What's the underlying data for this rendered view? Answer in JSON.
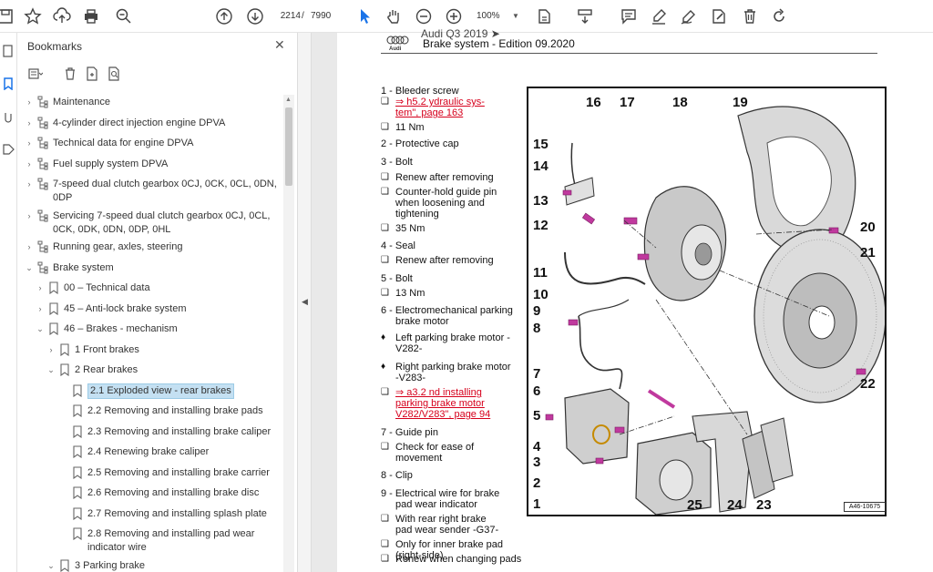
{
  "toolbar": {
    "page_current": "2214",
    "page_sep": "/",
    "page_total": "7990",
    "zoom": "100%",
    "icons": [
      "save-icon",
      "bookmark-star-icon",
      "upload-icon",
      "print-icon",
      "zoom-search-icon",
      "page-up-icon",
      "page-down-icon",
      "select-cursor-icon",
      "hand-icon",
      "zoom-out-icon",
      "zoom-in-icon",
      "fit-page-icon",
      "scroll-mode-icon",
      "comment-icon",
      "highlight-icon",
      "sign-icon",
      "edit-icon",
      "delete-icon",
      "rotate-icon"
    ]
  },
  "bookmarks_panel": {
    "title": "Bookmarks",
    "items": [
      {
        "label": "Maintenance",
        "level": 0,
        "chev": "›",
        "icon": "tree"
      },
      {
        "label": "4-cylinder direct injection engine DPVA",
        "level": 0,
        "chev": "›",
        "icon": "tree"
      },
      {
        "label": "Technical data for engine DPVA",
        "level": 0,
        "chev": "›",
        "icon": "tree"
      },
      {
        "label": "Fuel supply system DPVA",
        "level": 0,
        "chev": "›",
        "icon": "tree"
      },
      {
        "label": "7-speed dual clutch gearbox 0CJ, 0CK, 0CL, 0DN,",
        "label2": "0DP",
        "level": 0,
        "chev": "›",
        "icon": "tree"
      },
      {
        "label": "Servicing 7-speed dual clutch gearbox 0CJ, 0CL,",
        "label2": "0CK, 0DK, 0DN, 0DP, 0HL",
        "level": 0,
        "chev": "›",
        "icon": "tree"
      },
      {
        "label": "Running gear, axles, steering",
        "level": 0,
        "chev": "›",
        "icon": "tree"
      },
      {
        "label": "Brake system",
        "level": 0,
        "chev": "⌄",
        "icon": "tree"
      },
      {
        "label": "00 – Technical data",
        "level": 1,
        "chev": "›",
        "icon": "bm"
      },
      {
        "label": "45 – Anti-lock brake system",
        "level": 1,
        "chev": "›",
        "icon": "bm"
      },
      {
        "label": "46 – Brakes - mechanism",
        "level": 1,
        "chev": "⌄",
        "icon": "bm"
      },
      {
        "label": "1 Front brakes",
        "level": 2,
        "chev": "›",
        "icon": "bm"
      },
      {
        "label": "2 Rear brakes",
        "level": 2,
        "chev": "⌄",
        "icon": "bm"
      },
      {
        "label": "2.1 Exploded view - rear brakes",
        "level": 3,
        "chev": "",
        "icon": "bm",
        "selected": true
      },
      {
        "label": "2.2 Removing and installing brake pads",
        "level": 3,
        "chev": "",
        "icon": "bm"
      },
      {
        "label": "2.3 Removing and installing brake caliper",
        "level": 3,
        "chev": "",
        "icon": "bm"
      },
      {
        "label": "2.4 Renewing brake caliper",
        "level": 3,
        "chev": "",
        "icon": "bm"
      },
      {
        "label": "2.5 Removing and installing brake carrier",
        "level": 3,
        "chev": "",
        "icon": "bm"
      },
      {
        "label": "2.6 Removing and installing brake disc",
        "level": 3,
        "chev": "",
        "icon": "bm"
      },
      {
        "label": "2.7 Removing and installing splash plate",
        "level": 3,
        "chev": "",
        "icon": "bm"
      },
      {
        "label": "2.8 Removing and installing pad wear",
        "label2": "indicator wire",
        "level": 3,
        "chev": "",
        "icon": "bm"
      },
      {
        "label": "3 Parking brake",
        "level": 2,
        "chev": "⌄",
        "icon": "bm"
      }
    ]
  },
  "document": {
    "header_top": "Audi Q3 2019 ➤",
    "header_title": "Brake system - Edition 09.2020",
    "items": [
      {
        "b": "",
        "t": "1 - Bleeder screw",
        "bold": false
      },
      {
        "b": "❑",
        "t": "⇒ h5.2 ydraulic sys-",
        "link": true
      },
      {
        "b": "",
        "t": "tem\", page 163",
        "link": true
      },
      {
        "b": "❑",
        "t": "11 Nm"
      },
      {
        "b": "",
        "t": "2 - Protective cap"
      },
      {
        "b": "",
        "t": "3 - Bolt"
      },
      {
        "b": "❑",
        "t": "Renew after removing"
      },
      {
        "b": "❑",
        "t": "Counter-hold guide pin"
      },
      {
        "b": "",
        "t": "when loosening and"
      },
      {
        "b": "",
        "t": "tightening"
      },
      {
        "b": "❑",
        "t": "35 Nm"
      },
      {
        "b": "",
        "t": "4 - Seal"
      },
      {
        "b": "❑",
        "t": "Renew after removing"
      },
      {
        "b": "",
        "t": "5 - Bolt"
      },
      {
        "b": "❑",
        "t": "13 Nm"
      },
      {
        "b": "",
        "t": "6 - Electromechanical parking"
      },
      {
        "b": "",
        "t": "brake motor"
      },
      {
        "b": "♦",
        "t": "Left parking brake motor -"
      },
      {
        "b": "",
        "t": "V282-"
      },
      {
        "b": "♦",
        "t": "Right parking brake motor"
      },
      {
        "b": "",
        "t": "-V283-"
      },
      {
        "b": "❑",
        "t": "⇒ a3.2 nd installing",
        "link": true
      },
      {
        "b": "",
        "t": "parking brake motor",
        "link": true
      },
      {
        "b": "",
        "t": "V282/V283\", page 94",
        "link": true
      },
      {
        "b": "",
        "t": "7 - Guide pin"
      },
      {
        "b": "❑",
        "t": "Check for ease of"
      },
      {
        "b": "",
        "t": "movement"
      },
      {
        "b": "",
        "t": "8 - Clip"
      },
      {
        "b": "",
        "t": "9 - Electrical wire for brake"
      },
      {
        "b": "",
        "t": "pad wear indicator"
      },
      {
        "b": "❑",
        "t": "With rear right brake"
      },
      {
        "b": "",
        "t": "pad wear sender -G37-"
      },
      {
        "b": "❑",
        "t": "Only for inner brake pad (right-side)"
      },
      {
        "b": "❑",
        "t": "Renew when changing pads"
      }
    ],
    "figure_ref": "A46-10675",
    "callouts": [
      "1",
      "2",
      "3",
      "4",
      "5",
      "6",
      "7",
      "8",
      "9",
      "10",
      "11",
      "12",
      "13",
      "14",
      "15",
      "16",
      "17",
      "18",
      "19",
      "20",
      "21",
      "22",
      "23",
      "24",
      "25"
    ]
  },
  "colors": {
    "accent": "#1a73e8",
    "link": "#d6001c",
    "selection": "#c4e0f2",
    "bolt": "#c0399e"
  }
}
